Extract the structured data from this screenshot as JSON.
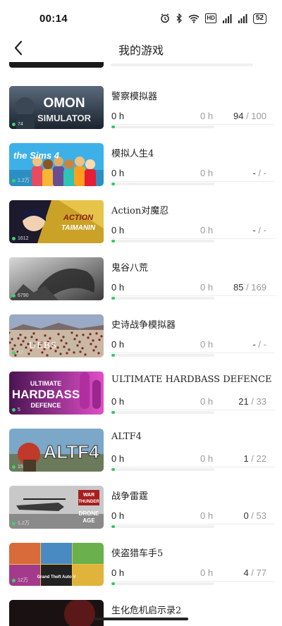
{
  "status_bar": {
    "time": "00:14",
    "network": "5G",
    "network2": "4G",
    "battery": "52",
    "hd": "HD"
  },
  "header": {
    "title": "我的游戏",
    "back_icon": "chevron-left-icon"
  },
  "accent_color": "#35c85f",
  "games": [
    {
      "name": "警察模拟器",
      "thumb_text": [
        "OMON",
        "SIMULATOR"
      ],
      "thumb_count": "74",
      "hours_recent": "0 h",
      "hours_total": "0 h",
      "ach_done": "94",
      "ach_total": "100"
    },
    {
      "name": "模拟人生4",
      "thumb_text": [
        "the Sims 4"
      ],
      "thumb_count": "1.2万",
      "hours_recent": "0 h",
      "hours_total": "0 h",
      "ach_done": "-",
      "ach_total": "-"
    },
    {
      "name": "Action对魔忍",
      "thumb_text": [
        "ACTION",
        "TAIMANIN"
      ],
      "thumb_count": "1612",
      "hours_recent": "0 h",
      "hours_total": "0 h",
      "ach_done": "-",
      "ach_total": "-"
    },
    {
      "name": "鬼谷八荒",
      "thumb_text": [],
      "thumb_count": "6790",
      "hours_recent": "0 h",
      "hours_total": "0 h",
      "ach_done": "85",
      "ach_total": "169"
    },
    {
      "name": "史诗战争模拟器",
      "thumb_text": [
        "UEBS"
      ],
      "thumb_count": "47",
      "hours_recent": "0 h",
      "hours_total": "0 h",
      "ach_done": "-",
      "ach_total": "-"
    },
    {
      "name": "ULTIMATE HARDBASS DEFENCE",
      "thumb_text": [
        "ULTIMATE",
        "HARDBASS",
        "DEFENCE"
      ],
      "thumb_count": "5",
      "hours_recent": "0 h",
      "hours_total": "0 h",
      "ach_done": "21",
      "ach_total": "33"
    },
    {
      "name": "ALTF4",
      "thumb_text": [
        "ALTF4"
      ],
      "thumb_count": "15",
      "hours_recent": "0 h",
      "hours_total": "0 h",
      "ach_done": "1",
      "ach_total": "22"
    },
    {
      "name": "战争雷霆",
      "thumb_text": [
        "WAR",
        "THUNDER",
        "DRONE",
        "AGE"
      ],
      "thumb_count": "1.2万",
      "hours_recent": "0 h",
      "hours_total": "0 h",
      "ach_done": "0",
      "ach_total": "53"
    },
    {
      "name": "侠盗猎车手5",
      "thumb_text": [
        "Grand Theft Auto V"
      ],
      "thumb_count": "12万",
      "hours_recent": "0 h",
      "hours_total": "0 h",
      "ach_done": "4",
      "ach_total": "77"
    },
    {
      "name": "生化危机启示录2",
      "thumb_text": [],
      "thumb_count": "",
      "hours_recent": "",
      "hours_total": "",
      "ach_done": "",
      "ach_total": ""
    }
  ]
}
